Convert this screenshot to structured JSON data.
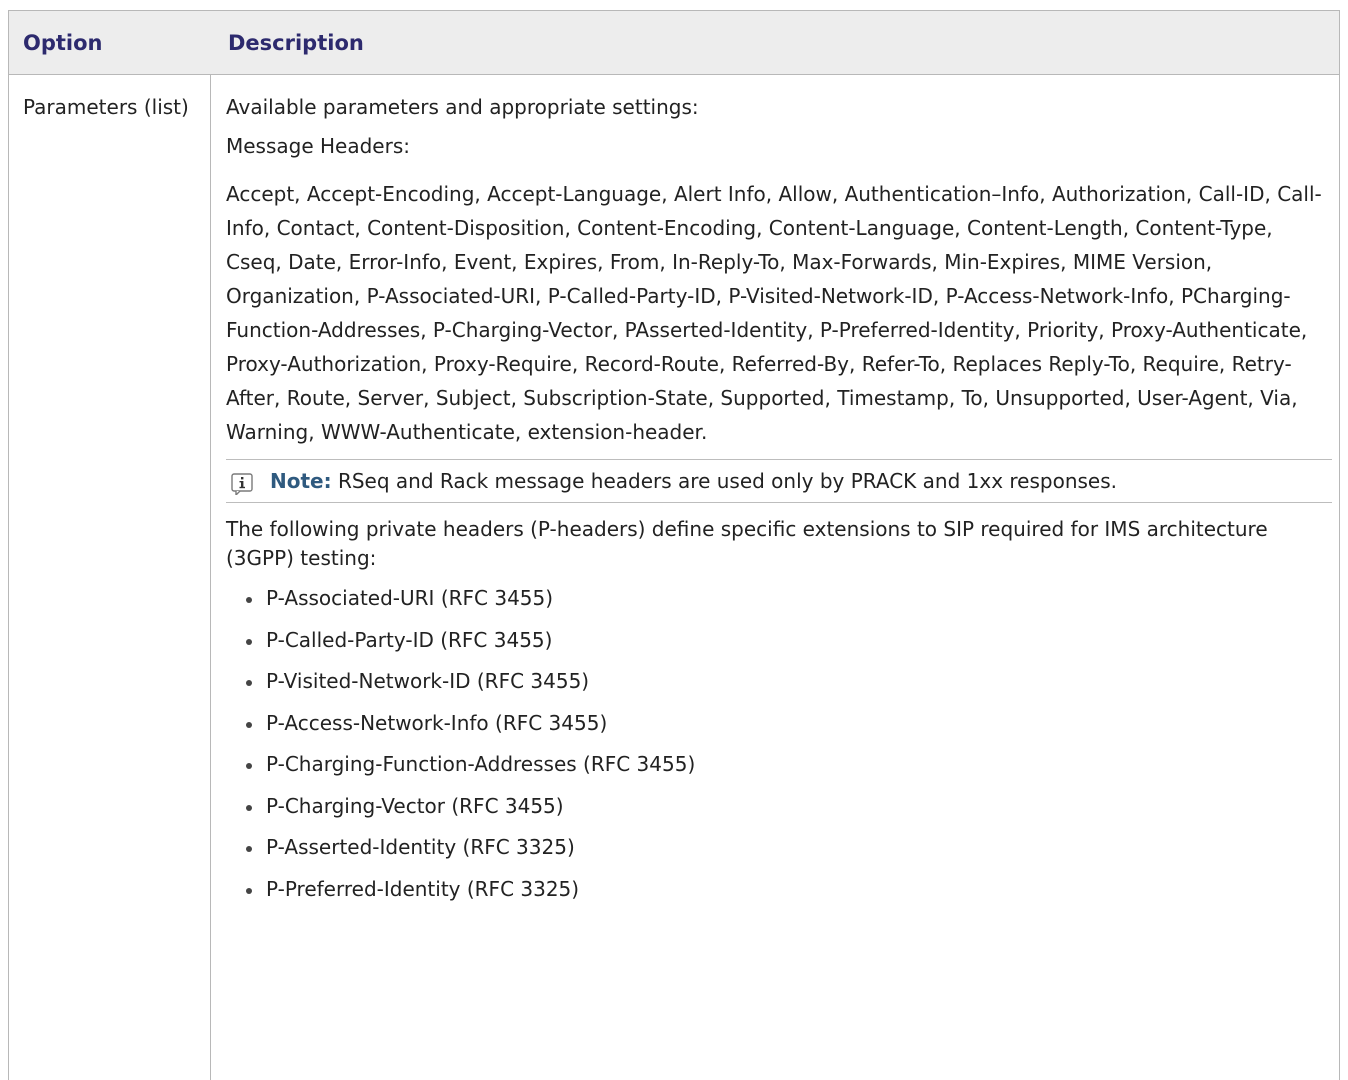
{
  "table": {
    "headers": {
      "option": "Option",
      "description": "Description"
    },
    "row": {
      "option": "Parameters (list)",
      "intro": "Available parameters and appropriate settings:",
      "message_headers_label": "Message Headers:",
      "message_headers_list": "Accept, Accept-Encoding, Accept-Language, Alert Info, Allow, Authentication–Info, Authorization, Call-ID, Call-Info, Contact, Content-Disposition, Content-Encoding, Content-Language, Content-Length, Content-Type, Cseq, Date, Error-Info, Event, Expires, From, In-Reply-To, Max-Forwards, Min-Expires, MIME Version, Organization, P-Associated-URI, P-Called-Party-ID, P-Visited-Network-ID, P-Access-Network-Info, PCharging-Function-Addresses, P-Charging-Vector, PAsserted-Identity, P-Preferred-Identity, Priority, Proxy-Authenticate, Proxy-Authorization, Proxy-Require, Record-Route, Referred-By, Refer-To, Replaces Reply-To, Require, Retry-After, Route, Server, Subject, Subscription-State, Supported, Timestamp, To, Unsupported, User-Agent, Via, Warning, WWW-Authenticate, extension-header.",
      "note": {
        "icon": "info-icon",
        "label": "Note:",
        "text": "RSeq and Rack message headers are used only by PRACK and 1xx responses."
      },
      "private_headers_intro": "The following private headers (P-headers) define specific extensions to SIP required for IMS architecture (3GPP) testing:",
      "private_headers": [
        "P-Associated-URI (RFC 3455)",
        "P-Called-Party-ID (RFC 3455)",
        "P-Visited-Network-ID (RFC 3455)",
        "P-Access-Network-Info (RFC 3455)",
        "P-Charging-Function-Addresses (RFC 3455)",
        "P-Charging-Vector (RFC 3455)",
        "P-Asserted-Identity (RFC 3325)",
        "P-Preferred-Identity (RFC 3325)"
      ]
    }
  },
  "colors": {
    "header_bg": "#ededed",
    "header_text": "#2d2a6e",
    "note_label": "#2f5a7f",
    "border": "#b8b8b8"
  }
}
